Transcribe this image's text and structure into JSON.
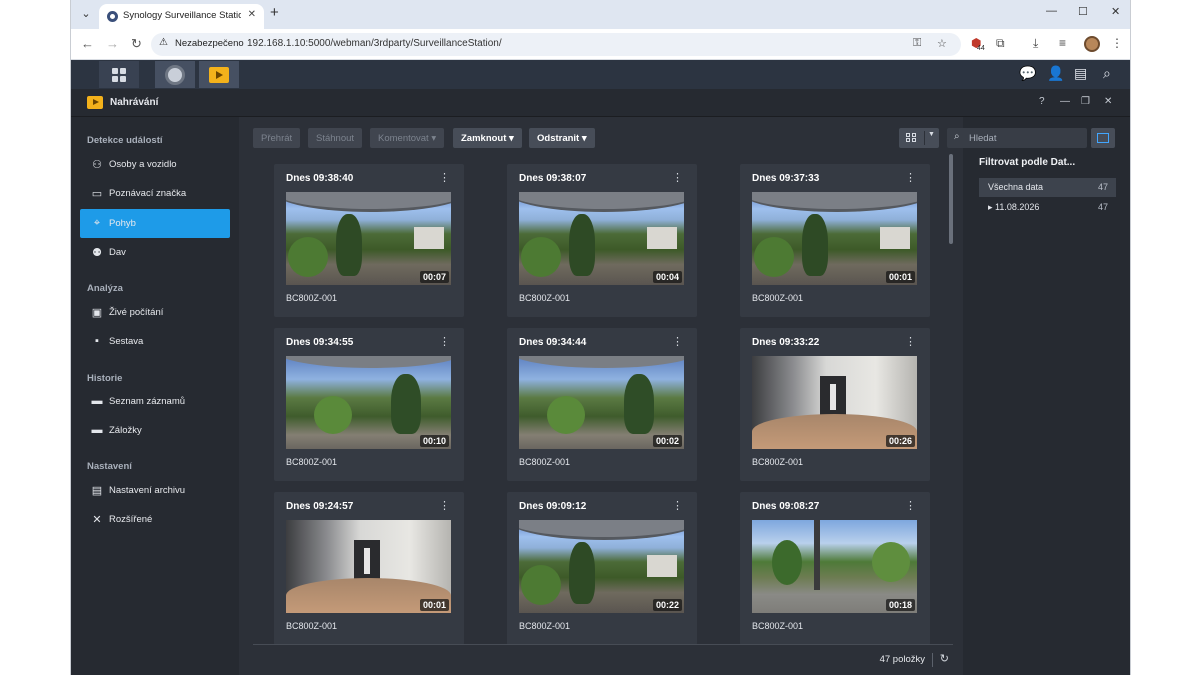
{
  "browser": {
    "tab_title": "Synology Surveillance Station -",
    "security_label": "Nezabezpečeno",
    "url": "192.168.1.10:5000/webman/3rdparty/SurveillanceStation/",
    "ext_badge": "44"
  },
  "window": {
    "title": "Nahrávání"
  },
  "sidebar": {
    "sections": [
      {
        "label": "Detekce událostí",
        "items": [
          {
            "label": "Osoby a vozidlo",
            "icon": "person-vehicle-icon"
          },
          {
            "label": "Poznávací značka",
            "icon": "license-plate-icon"
          },
          {
            "label": "Pohyb",
            "icon": "motion-icon",
            "active": true
          },
          {
            "label": "Dav",
            "icon": "crowd-icon"
          }
        ]
      },
      {
        "label": "Analýza",
        "items": [
          {
            "label": "Živé počítání",
            "icon": "counting-icon"
          },
          {
            "label": "Sestava",
            "icon": "report-icon"
          }
        ]
      },
      {
        "label": "Historie",
        "items": [
          {
            "label": "Seznam záznamů",
            "icon": "folder-icon"
          },
          {
            "label": "Záložky",
            "icon": "bookmark-folder-icon"
          }
        ]
      },
      {
        "label": "Nastavení",
        "items": [
          {
            "label": "Nastavení archivu",
            "icon": "archive-icon"
          },
          {
            "label": "Rozšířené",
            "icon": "tools-icon"
          }
        ]
      }
    ]
  },
  "toolbar": {
    "play": "Přehrát",
    "download": "Stáhnout",
    "comment": "Komentovat ▾",
    "lock": "Zamknout ▾",
    "delete": "Odstranit ▾"
  },
  "recordings": [
    {
      "title": "Dnes 09:38:40",
      "duration": "00:07",
      "camera": "BC800Z-001",
      "scene": "garden"
    },
    {
      "title": "Dnes 09:38:07",
      "duration": "00:04",
      "camera": "BC800Z-001",
      "scene": "garden"
    },
    {
      "title": "Dnes 09:37:33",
      "duration": "00:01",
      "camera": "BC800Z-001",
      "scene": "garden"
    },
    {
      "title": "Dnes 09:34:55",
      "duration": "00:10",
      "camera": "BC800Z-001",
      "scene": "garden2"
    },
    {
      "title": "Dnes 09:34:44",
      "duration": "00:02",
      "camera": "BC800Z-001",
      "scene": "garden2"
    },
    {
      "title": "Dnes 09:33:22",
      "duration": "00:26",
      "camera": "BC800Z-001",
      "scene": "hall"
    },
    {
      "title": "Dnes 09:24:57",
      "duration": "00:01",
      "camera": "BC800Z-001",
      "scene": "hall"
    },
    {
      "title": "Dnes 09:09:12",
      "duration": "00:22",
      "camera": "BC800Z-001",
      "scene": "garden"
    },
    {
      "title": "Dnes 09:08:27",
      "duration": "00:18",
      "camera": "BC800Z-001",
      "scene": "terrace"
    }
  ],
  "footer": {
    "count": "47 položky"
  },
  "search": {
    "placeholder": "Hledat"
  },
  "filter": {
    "title": "Filtrovat podle Dat...",
    "all_label": "Všechna data",
    "all_count": "47",
    "date_label": "▸ 11.08.2026",
    "date_count": "47"
  },
  "colors": {
    "accent": "#1e9be8",
    "window_bg": "#202227",
    "card_bg": "#353a43"
  }
}
